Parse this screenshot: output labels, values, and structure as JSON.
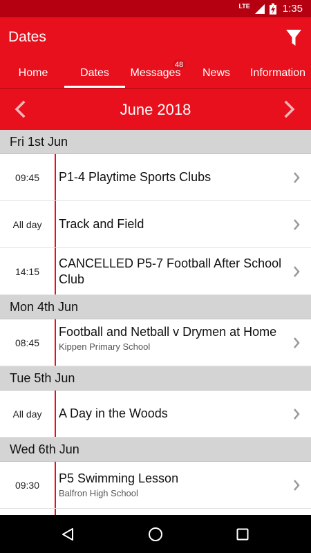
{
  "status_bar": {
    "network": "LTE",
    "battery_icon": "battery-charging-icon",
    "signal_icon": "signal-icon",
    "time": "1:35"
  },
  "app_bar": {
    "title": "Dates",
    "filter_icon": "filter-icon"
  },
  "tabs": [
    {
      "label": "Home",
      "active": false
    },
    {
      "label": "Dates",
      "active": true
    },
    {
      "label": "Messages",
      "badge": "48",
      "active": false
    },
    {
      "label": "News",
      "active": false
    },
    {
      "label": "Information",
      "active": false
    }
  ],
  "month": {
    "label": "June 2018",
    "prev_icon": "chevron-left-icon",
    "next_icon": "chevron-right-icon"
  },
  "days": [
    {
      "label": "Fri 1st Jun",
      "events": [
        {
          "time": "09:45",
          "title": "P1-4 Playtime Sports Clubs",
          "subtitle": ""
        },
        {
          "time": "All day",
          "title": "Track and Field",
          "subtitle": ""
        },
        {
          "time": "14:15",
          "title": "CANCELLED P5-7 Football After School Club",
          "subtitle": ""
        }
      ]
    },
    {
      "label": "Mon 4th Jun",
      "events": [
        {
          "time": "08:45",
          "title": "Football and Netball v Drymen at Home",
          "subtitle": "Kippen Primary School"
        }
      ]
    },
    {
      "label": "Tue 5th Jun",
      "events": [
        {
          "time": "All day",
          "title": "A Day in the Woods",
          "subtitle": ""
        }
      ]
    },
    {
      "label": "Wed 6th Jun",
      "events": [
        {
          "time": "09:30",
          "title": "P5 Swimming Lesson",
          "subtitle": "Balfron High School"
        }
      ]
    }
  ],
  "colors": {
    "brand_red": "#e8101d",
    "status_bar": "#b50011",
    "day_header": "#d4d4d4"
  },
  "nav_bar": {
    "back_icon": "back-icon",
    "home_icon": "home-icon",
    "recents_icon": "recents-icon"
  }
}
